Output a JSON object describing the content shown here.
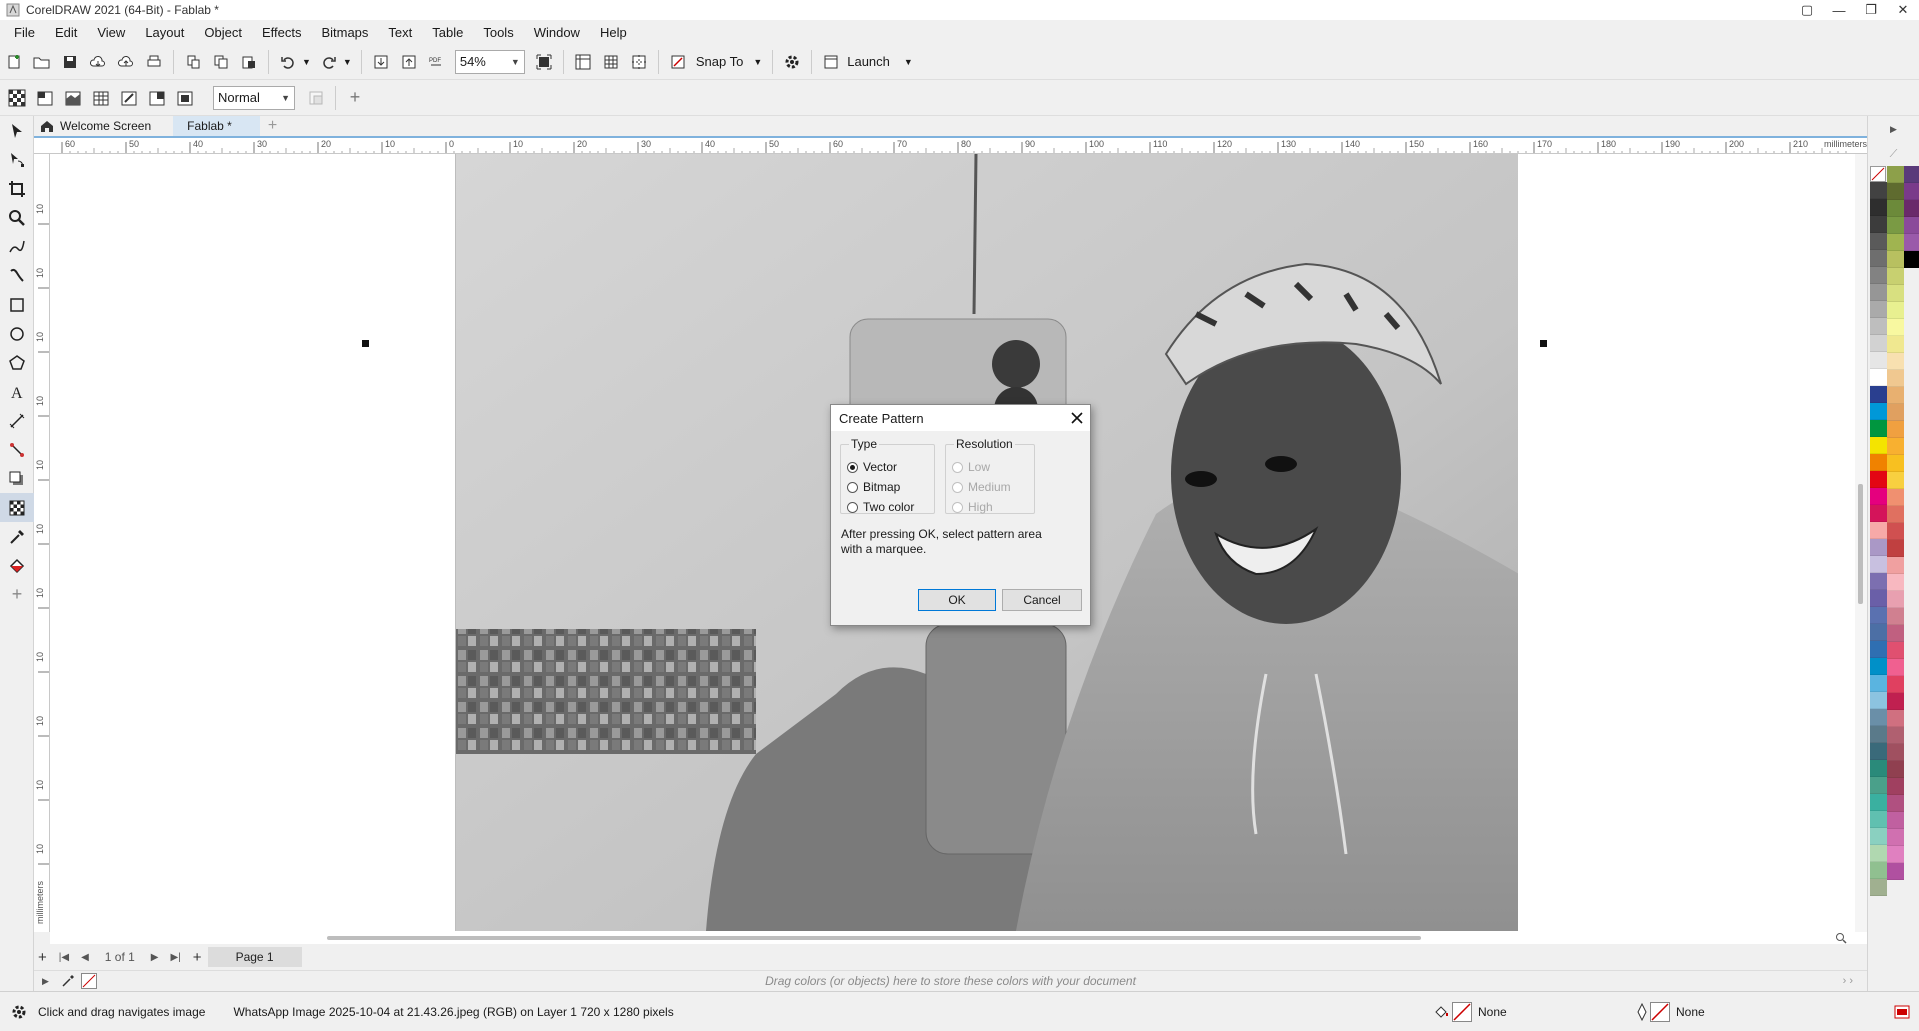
{
  "window": {
    "title": "CorelDRAW 2021 (64-Bit) - Fablab *"
  },
  "menu": [
    "File",
    "Edit",
    "View",
    "Layout",
    "Object",
    "Effects",
    "Bitmaps",
    "Text",
    "Table",
    "Tools",
    "Window",
    "Help"
  ],
  "toolbar": {
    "zoom": "54%",
    "snap_label": "Snap To",
    "launch_label": "Launch"
  },
  "property_bar": {
    "blend_mode": "Normal"
  },
  "tabs": [
    {
      "label": "Welcome Screen"
    },
    {
      "label": "Fablab *"
    }
  ],
  "ruler": {
    "unit": "millimeters",
    "h_ticks": [
      "60",
      "50",
      "40",
      "30",
      "20",
      "10",
      "0",
      "10",
      "20",
      "30",
      "40",
      "50",
      "60",
      "70",
      "80",
      "90",
      "100",
      "110",
      "120",
      "130",
      "140",
      "150",
      "160",
      "170",
      "180",
      "190",
      "200",
      "210"
    ],
    "v_ticks": [
      "10",
      "10",
      "10",
      "10",
      "10",
      "10",
      "10",
      "10",
      "10",
      "10",
      "10"
    ]
  },
  "dialog": {
    "title": "Create Pattern",
    "type_label": "Type",
    "type_options": [
      "Vector",
      "Bitmap",
      "Two color"
    ],
    "type_selected": "Vector",
    "resolution_label": "Resolution",
    "resolution_options": [
      "Low",
      "Medium",
      "High"
    ],
    "hint_line1": "After pressing OK, select pattern area",
    "hint_line2": "with a marquee.",
    "ok_label": "OK",
    "cancel_label": "Cancel"
  },
  "pages": {
    "counter": "1 of 1",
    "page_tab": "Page 1"
  },
  "colorbar_hint": "Drag colors (or objects) here to store these colors with your document",
  "status": {
    "hint": "Click and drag navigates image",
    "info": "WhatsApp Image 2025-10-04 at 21.43.26.jpeg (RGB) on Layer 1 720 x 1280 pixels",
    "fill": "None",
    "outline": "None"
  },
  "palette": {
    "col1": [
      "#424242",
      "#2e2e2e",
      "#3c3c3c",
      "#5a5a5a",
      "#6e6e6e",
      "#828282",
      "#969696",
      "#aaaaaa",
      "#bebebe",
      "#d2d2d2",
      "#e6e6e6",
      "#ffffff",
      "#2a3f8f",
      "#0098d8",
      "#00963f",
      "#f4e400",
      "#f08200",
      "#e30613",
      "#e5007e",
      "#d4145a",
      "#f7a9a8",
      "#aa98c6",
      "#c8c0e0",
      "#7c6fb0",
      "#6a5fa8",
      "#5a71b0",
      "#4c6fa5",
      "#2f6fb2",
      "#0090c8",
      "#5ab4e0",
      "#8cc3e0",
      "#6a8fa8",
      "#5a7a8a",
      "#3a6a7a",
      "#2a8a7a",
      "#4aa08a",
      "#3ab0a0",
      "#60c0b0",
      "#8ad0c0",
      "#b0d8b0",
      "#90c090",
      "#a0b090"
    ],
    "col2": [
      "#8da04a",
      "#5f6b2f",
      "#6c8a3a",
      "#7a9a44",
      "#a0b450",
      "#b8c060",
      "#c8d070",
      "#d8e080",
      "#e8f090",
      "#f8f8a0",
      "#f0e890",
      "#f8e0b0",
      "#f0c890",
      "#e8b070",
      "#e0a060",
      "#f0a040",
      "#f8b030",
      "#f8c020",
      "#f8d040",
      "#f09070",
      "#e07060",
      "#d05050",
      "#c04040",
      "#f0a0a0",
      "#f8b8c0",
      "#e8a0b0",
      "#d08090",
      "#c06080",
      "#e05070",
      "#f06090",
      "#e04060",
      "#c02050",
      "#d07080",
      "#b06070",
      "#a05060",
      "#904050",
      "#a04060",
      "#b05080",
      "#c060a0",
      "#d070b0",
      "#e080c0",
      "#b050a0"
    ],
    "col3": [
      "#5a3a7a",
      "#7a3a8a",
      "#6a2a6a",
      "#8a4a9a",
      "#9a5aaa",
      "#000000"
    ]
  }
}
